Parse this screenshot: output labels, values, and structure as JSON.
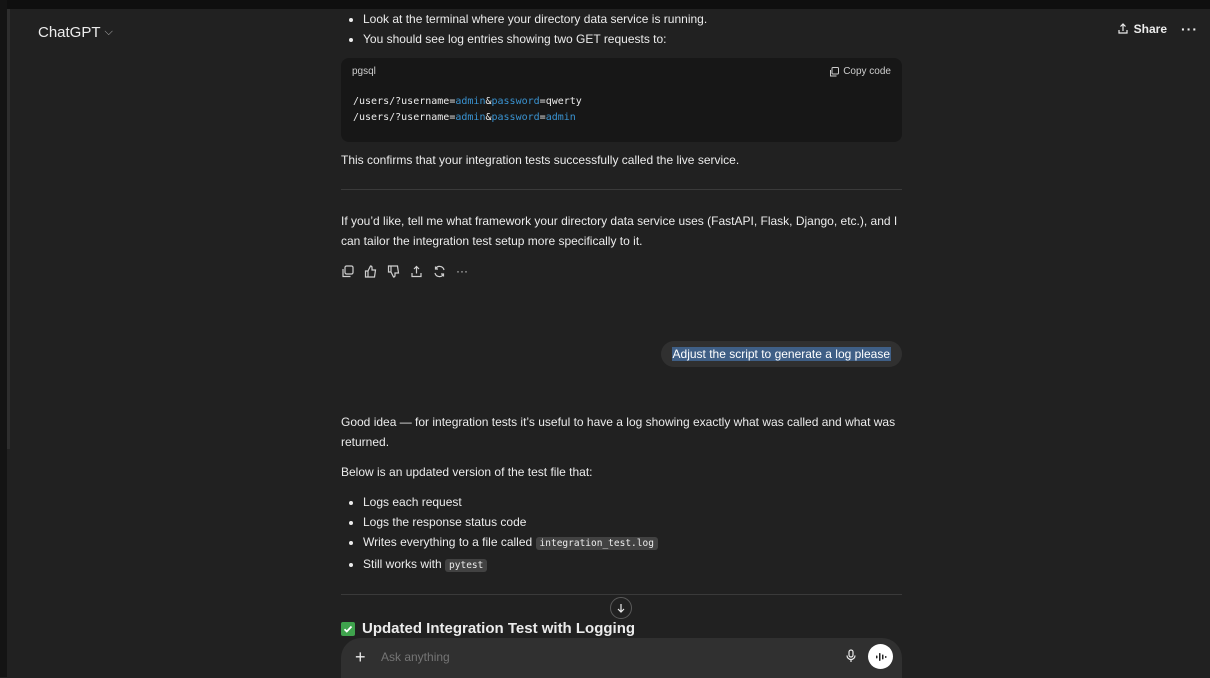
{
  "header": {
    "title": "ChatGPT",
    "share_label": "Share",
    "more_label": "···"
  },
  "assistant_1": {
    "bullets": [
      "Look at the terminal where your directory data service is running.",
      "You should see log entries showing two GET requests to:"
    ],
    "code": {
      "lang": "pgsql",
      "copy_label": "Copy code",
      "line1": {
        "path": "/users/?username=",
        "k1": "admin",
        "amp": "&",
        "k2": "password",
        "tail": "=qwerty"
      },
      "line2": {
        "path": "/users/?username=",
        "k1": "admin",
        "amp": "&",
        "k2": "password",
        "eq": "=",
        "k3": "admin"
      }
    },
    "confirm": "This confirms that your integration tests successfully called the live service.",
    "followup": "If you’d like, tell me what framework your directory data service uses (FastAPI, Flask, Django, etc.), and I can tailor the integration test setup more specifically to it.",
    "more_actions": "···"
  },
  "user_message": "Adjust the script to generate a log please",
  "assistant_2": {
    "intro": "Good idea — for integration tests it’s useful to have a log showing exactly what was called and what was returned.",
    "below": "Below is an updated version of the test file that:",
    "bullets": [
      "Logs each request",
      "Logs the response status code",
      "Writes everything to a file called",
      "Still works with"
    ],
    "code_file": "integration_test.log",
    "code_pytest": "pytest",
    "heading": "Updated Integration Test with Logging"
  },
  "composer": {
    "placeholder": "Ask anything",
    "plus_label": "+"
  },
  "colors": {
    "background": "#212121",
    "code_bg": "#171717",
    "keyword": "#3a93d1",
    "selection": "#3f5f86",
    "check": "#3fa34d"
  }
}
